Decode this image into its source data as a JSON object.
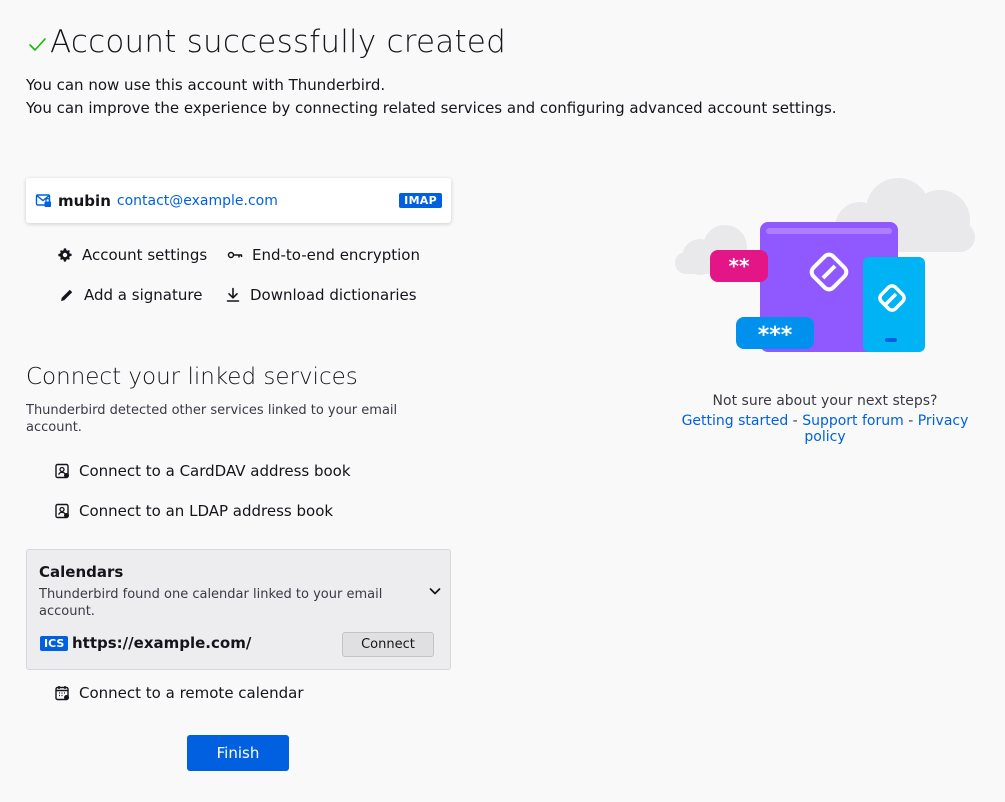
{
  "header": {
    "title": "Account successfully created",
    "line1": "You can now use this account with Thunderbird.",
    "line2": "You can improve the experience by connecting related services and configuring advanced account settings."
  },
  "account": {
    "name": "mubin",
    "email": "contact@example.com",
    "protocol": "IMAP"
  },
  "actions": {
    "account_settings": "Account settings",
    "e2e": "End-to-end encryption",
    "signature": "Add a signature",
    "dictionaries": "Download dictionaries"
  },
  "linked": {
    "title": "Connect your linked services",
    "desc": "Thunderbird detected other services linked to your email account.",
    "carddav": "Connect to a CardDAV address book",
    "ldap": "Connect to an LDAP address book",
    "remote_calendar": "Connect to a remote calendar"
  },
  "calendars": {
    "title": "Calendars",
    "desc": "Thunderbird found one calendar linked to your email account.",
    "type": "ICS",
    "url": "https://example.com/",
    "connect_label": "Connect"
  },
  "finish_label": "Finish",
  "help": {
    "prompt": "Not sure about your next steps?",
    "getting_started": "Getting started",
    "support_forum": "Support forum",
    "privacy_policy": "Privacy policy",
    "separator": " - "
  },
  "colors": {
    "accent": "#0060df",
    "success": "#2ac3a2",
    "purple": "#9059ff",
    "cyan": "#00b3f4"
  }
}
